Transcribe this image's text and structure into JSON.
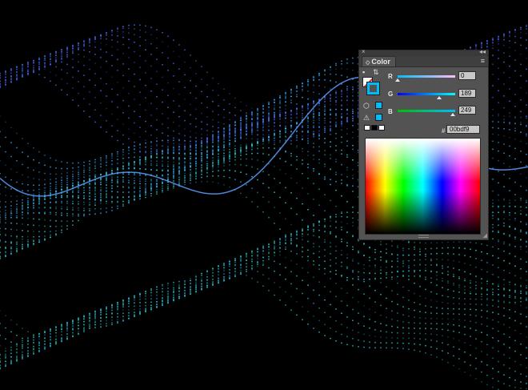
{
  "panel": {
    "close_glyph": "×",
    "collapse_glyph": "◂◂",
    "tab_arrows": "◇",
    "tab_title": "Color",
    "menu_glyph": "≡",
    "channels": [
      {
        "label": "R",
        "value": "0",
        "gradient_end": "#ff00ff"
      },
      {
        "label": "G",
        "value": "189",
        "gradient_end": "#00ffff"
      },
      {
        "label": "B",
        "value": "249",
        "gradient_end": "#00ffff"
      }
    ],
    "hex_label": "#",
    "hex_value": "00bdf9",
    "accent_color": "#00bdf9"
  }
}
